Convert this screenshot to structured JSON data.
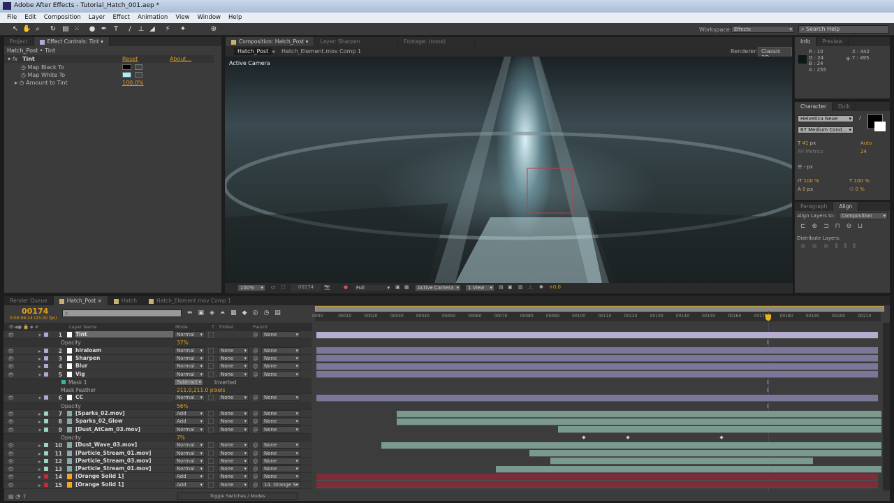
{
  "app": {
    "title": "Adobe After Effects - Tutorial_Hatch_001.aep *",
    "logo": "Ae"
  },
  "menu": [
    "File",
    "Edit",
    "Composition",
    "Layer",
    "Effect",
    "Animation",
    "View",
    "Window",
    "Help"
  ],
  "toolbar": {
    "workspace_label": "Workspace:",
    "workspace_value": "Effects",
    "search_placeholder": "Search Help"
  },
  "effect_controls": {
    "tabs": [
      "Project",
      "Effect Controls: Tint"
    ],
    "breadcrumb": "Hatch_Post • Tint",
    "effect_name": "Tint",
    "reset": "Reset",
    "about": "About...",
    "props": [
      {
        "label": "Map Black To",
        "color": "#000000"
      },
      {
        "label": "Map White To",
        "color": "#a8f0f8"
      },
      {
        "label": "Amount to Tint",
        "value": "100.0%"
      }
    ]
  },
  "composition": {
    "tabs": [
      "Composition: Hatch_Post",
      "Layer: Sharpen",
      "Footage: (none)"
    ],
    "crumbs": [
      "Hatch_Post",
      "Hatch_Element.mov Comp 1"
    ],
    "renderer_label": "Renderer:",
    "renderer": "Classic 3D",
    "camera_label": "Active Camera",
    "bottom": {
      "zoom": "100%",
      "timecode": "00174",
      "resolution": "Full",
      "camera": "Active Camera",
      "views": "1 View",
      "exposure": "+0.0"
    }
  },
  "info": {
    "tabs": [
      "Info",
      "Preview"
    ],
    "r": "R : 10",
    "g": "G : 24",
    "b": "B : 24",
    "a": "A : 255",
    "x": "X : 442",
    "y": "Y : 495",
    "sample_color": "#0a1818"
  },
  "character": {
    "tabs": [
      "Character",
      "Duik"
    ],
    "font": "Helvetica Neue",
    "style": "67 Medium Cond...",
    "size": "41",
    "size_unit": "px",
    "leading": "Auto",
    "kerning": "Metrics",
    "tracking": "24",
    "stroke": "-",
    "stroke_unit": "px",
    "vscale": "100 %",
    "hscale": "100 %",
    "baseline": "0",
    "baseline_unit": "px",
    "tsume": "0 %"
  },
  "align": {
    "tabs": [
      "Paragraph",
      "Align"
    ],
    "align_to_label": "Align Layers to:",
    "align_to": "Composition",
    "distribute_label": "Distribute Layers:"
  },
  "timeline": {
    "tabs": [
      "Render Queue",
      "Hatch_Post",
      "Hatch",
      "Hatch_Element.mov Comp 1"
    ],
    "timecode": "00174",
    "timecode_sub": "0:00:06:24 (25.00 fps)",
    "search_placeholder": "",
    "headers": {
      "layer_name": "Layer Name",
      "mode": "Mode",
      "t": "T",
      "trkmat": "TrkMat",
      "parent": "Parent"
    },
    "ruler": [
      "0000",
      "00010",
      "00020",
      "00030",
      "00040",
      "00050",
      "00060",
      "00070",
      "00080",
      "00090",
      "00100",
      "00110",
      "00120",
      "00130",
      "00140",
      "00150",
      "00160",
      "00170",
      "00180",
      "00190",
      "00200",
      "00210"
    ],
    "current_frame": 174,
    "toggle_label": "Toggle Switches / Modes",
    "rows": [
      {
        "type": "layer",
        "num": "1",
        "name": "Tint",
        "label": "#b3a9d8",
        "icon": "solid",
        "mode": "Normal",
        "trkmat": "",
        "parent": "None",
        "expanded": true,
        "in": 0,
        "out": 216,
        "bar": "#b5acd0"
      },
      {
        "type": "prop",
        "name": "Opacity",
        "value": "37%",
        "marker": true
      },
      {
        "type": "layer",
        "num": "2",
        "name": "hiraloam",
        "label": "#b3a9d8",
        "icon": "solid",
        "mode": "Normal",
        "trkmat": "None",
        "parent": "None",
        "in": 0,
        "out": 216,
        "bar": "#7b7799"
      },
      {
        "type": "layer",
        "num": "3",
        "name": "Sharpen",
        "label": "#b3a9d8",
        "icon": "solid",
        "mode": "Normal",
        "trkmat": "None",
        "parent": "None",
        "in": 0,
        "out": 216,
        "bar": "#7b7799"
      },
      {
        "type": "layer",
        "num": "4",
        "name": "Blur",
        "label": "#b3a9d8",
        "icon": "solid",
        "mode": "Normal",
        "trkmat": "None",
        "parent": "None",
        "in": 0,
        "out": 216,
        "bar": "#7b7799"
      },
      {
        "type": "layer",
        "num": "5",
        "name": "Vig",
        "label": "#b3a9d8",
        "icon": "solid",
        "mode": "Normal",
        "trkmat": "None",
        "parent": "None",
        "expanded": true,
        "in": 0,
        "out": 216,
        "bar": "#7b7799"
      },
      {
        "type": "mask",
        "name": "Mask 1",
        "mode": "Subtract",
        "inverted": "Inverted",
        "marker": true
      },
      {
        "type": "prop",
        "name": "Mask Feather",
        "value": "211.0,211.0 pixels",
        "marker": true
      },
      {
        "type": "layer",
        "num": "6",
        "name": "CC",
        "label": "#b3a9d8",
        "icon": "solid",
        "mode": "Normal",
        "trkmat": "None",
        "parent": "None",
        "expanded": true,
        "in": 0,
        "out": 216,
        "bar": "#7b7799"
      },
      {
        "type": "prop",
        "name": "Opacity",
        "value": "56%",
        "marker": true
      },
      {
        "type": "layer",
        "num": "7",
        "name": "[Sparks_02.mov]",
        "label": "#9fd3c7",
        "icon": "footage",
        "mode": "Add",
        "trkmat": "None",
        "parent": "None",
        "in": 31,
        "out": 218,
        "bar": "#7a9a90"
      },
      {
        "type": "layer",
        "num": "8",
        "name": "Sparks_02_Glow",
        "label": "#9fd3c7",
        "icon": "footage",
        "mode": "Add",
        "trkmat": "None",
        "parent": "None",
        "in": 31,
        "out": 218,
        "bar": "#7a9a90"
      },
      {
        "type": "layer",
        "num": "9",
        "name": "[Dust_AtCam_03.mov]",
        "label": "#9fd3c7",
        "icon": "footage",
        "mode": "Normal",
        "trkmat": "None",
        "parent": "None",
        "expanded": true,
        "in": 93,
        "out": 218,
        "bar": "#7a9a90"
      },
      {
        "type": "prop",
        "name": "Opacity",
        "value": "7%",
        "keyframes": [
          103,
          120,
          156
        ]
      },
      {
        "type": "layer",
        "num": "10",
        "name": "[Dust_Wave_03.mov]",
        "label": "#9fd3c7",
        "icon": "footage",
        "mode": "Normal",
        "trkmat": "None",
        "parent": "None",
        "in": 25,
        "out": 218,
        "bar": "#7a9a90"
      },
      {
        "type": "layer",
        "num": "11",
        "name": "[Particle_Stream_01.mov]",
        "label": "#9fd3c7",
        "icon": "footage",
        "mode": "Normal",
        "trkmat": "None",
        "parent": "None",
        "in": 82,
        "out": 218,
        "bar": "#7a9a90"
      },
      {
        "type": "layer",
        "num": "12",
        "name": "[Particle_Stream_03.mov]",
        "label": "#9fd3c7",
        "icon": "footage",
        "mode": "Normal",
        "trkmat": "None",
        "parent": "None",
        "in": 90,
        "out": 191,
        "bar": "#7a9a90"
      },
      {
        "type": "layer",
        "num": "13",
        "name": "[Particle_Stream_01.mov]",
        "label": "#9fd3c7",
        "icon": "footage",
        "mode": "Normal",
        "trkmat": "None",
        "parent": "None",
        "in": 69,
        "out": 218,
        "bar": "#7a9a90"
      },
      {
        "type": "layer",
        "num": "14",
        "name": "[Orange Solid 1]",
        "label": "#c8283a",
        "icon": "orange-solid",
        "mode": "Add",
        "trkmat": "None",
        "parent": "None",
        "in": 0,
        "out": 216,
        "bar": "#7c2e38"
      },
      {
        "type": "layer",
        "num": "15",
        "name": "[Orange Solid 1]",
        "label": "#c8283a",
        "icon": "orange-solid",
        "mode": "Add",
        "trkmat": "None",
        "parent": "14. Orange S",
        "in": 0,
        "out": 216,
        "bar": "#7c2e38"
      }
    ]
  }
}
